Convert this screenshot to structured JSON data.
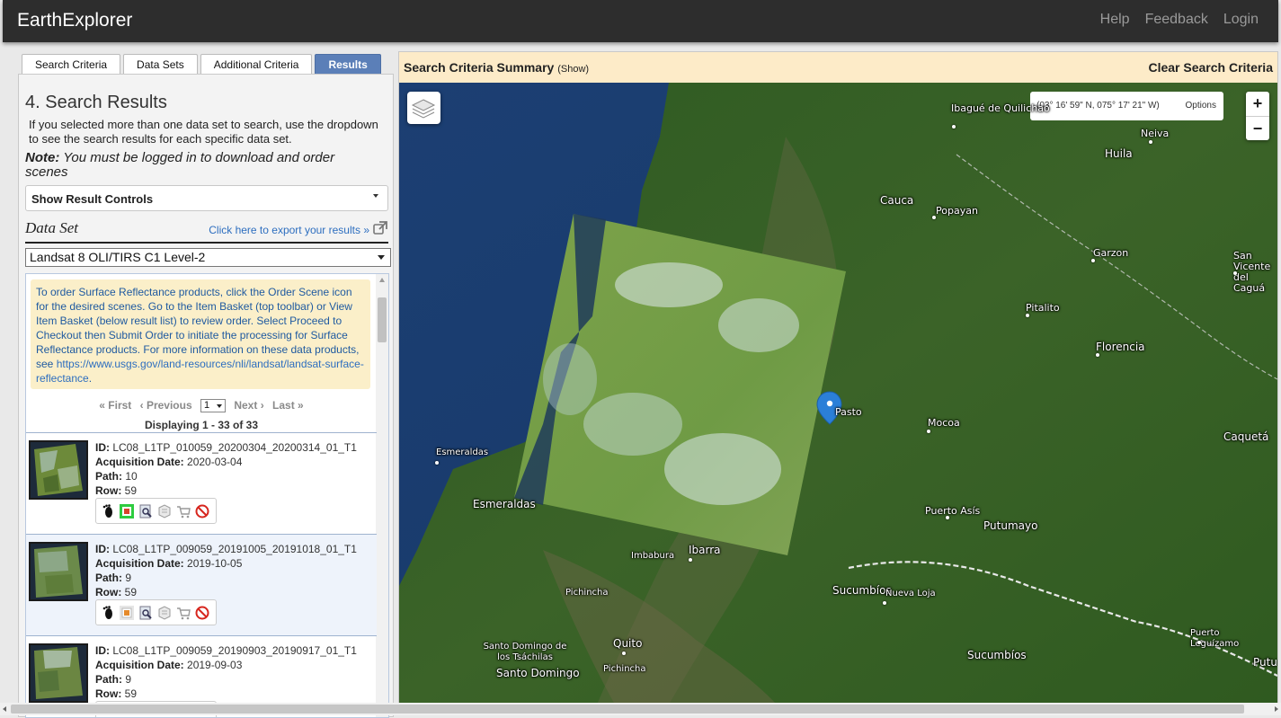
{
  "app": {
    "title": "EarthExplorer"
  },
  "topnav": {
    "help": "Help",
    "feedback": "Feedback",
    "login": "Login"
  },
  "tabs": [
    {
      "label": "Search Criteria"
    },
    {
      "label": "Data Sets"
    },
    {
      "label": "Additional Criteria"
    },
    {
      "label": "Results",
      "active": true
    }
  ],
  "results": {
    "heading": "4. Search Results",
    "intro": "If you selected more than one data set to search, use the dropdown to see the search results for each specific data set.",
    "note_label": "Note:",
    "note_text": " You must be logged in to download and order scenes",
    "controls_label": "Show Result Controls",
    "dataset_label": "Data Set",
    "export_link": "Click here to export your results »",
    "dataset_selected": "Landsat 8 OLI/TIRS C1 Level-2",
    "notice_text": "To order Surface Reflectance products, click the Order Scene icon for the desired scenes. Go to the Item Basket (top toolbar) or View Item Basket (below result list) to review order. Select Proceed to Checkout then Submit Order to initiate the processing for Surface Reflectance products. For more information on these data products, see ",
    "notice_link": "https://www.usgs.gov/land-resources/nli/landsat/landsat-surface-reflectance",
    "notice_end": ".",
    "pager": {
      "first": "« First",
      "previous": "‹ Previous",
      "page": "1",
      "next": "Next ›",
      "last": "Last »"
    },
    "displaying": "Displaying 1 - 33 of 33",
    "items": [
      {
        "id_label": "ID:",
        "id": "LC08_L1TP_010059_20200304_20200314_01_T1",
        "date_label": "Acquisition Date:",
        "date": "2020-03-04",
        "path_label": "Path:",
        "path": "10",
        "row_label": "Row:",
        "row": "59"
      },
      {
        "id_label": "ID:",
        "id": "LC08_L1TP_009059_20191005_20191018_01_T1",
        "date_label": "Acquisition Date:",
        "date": "2019-10-05",
        "path_label": "Path:",
        "path": "9",
        "row_label": "Row:",
        "row": "59"
      },
      {
        "id_label": "ID:",
        "id": "LC08_L1TP_009059_20190903_20190917_01_T1",
        "date_label": "Acquisition Date:",
        "date": "2019-09-03",
        "path_label": "Path:",
        "path": "9",
        "row_label": "Row:",
        "row": "59"
      }
    ],
    "row_icons": [
      "footprint-icon",
      "browse-overlay-icon",
      "metadata-icon",
      "bulk-download-icon",
      "order-cart-icon",
      "exclude-icon"
    ]
  },
  "map": {
    "summary_title": "Search Criteria Summary",
    "summary_show": "(Show)",
    "clear": "Clear Search Criteria",
    "coords": "(03° 16' 59\" N, 075° 17' 21\" W)",
    "options": "Options",
    "zoom_in": "+",
    "zoom_out": "−",
    "places": [
      "Ibagué de Quilichao",
      "Neiva",
      "Huila",
      "Cauca",
      "Popayan",
      "Garzon",
      "San Vicente del Caguá",
      "Pitalito",
      "Florencia",
      "Pasto",
      "Mocoa",
      "Caquetá",
      "Esmeraldas",
      "Esmeraldas",
      "Puerto Asís",
      "Putumayo",
      "Imbabura",
      "Ibarra",
      "Pichincha",
      "Sucumbíos",
      "Nueva Loja",
      "Quito",
      "Santo Domingo de los Tsáchilas",
      "Santo Domingo",
      "Pichincha",
      "Sucumbíos",
      "Puerto Leguízamo",
      "Putu"
    ],
    "colors": {
      "summary_bg": "#fdebc8",
      "active_tab": "#5b7fb8",
      "marker": "#2b7fd8"
    }
  }
}
